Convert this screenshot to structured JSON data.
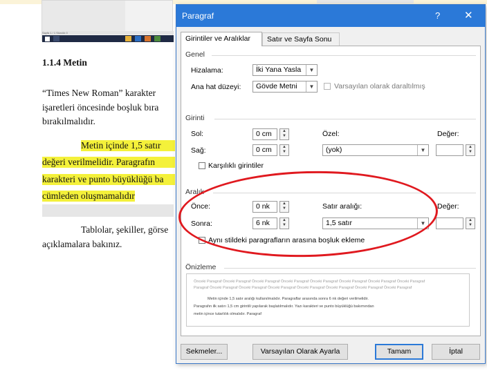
{
  "document": {
    "status_bar": "Sayfa 1 / 1   Sözcük 0",
    "heading": "1.1.4 Metin",
    "paragraph1": [
      "“Times New Roman” karakter",
      "işaretleri öncesinde boşluk bıra",
      "bırakılmalıdır."
    ],
    "highlighted": [
      "Metin içinde 1,5 satır",
      "değeri verilmelidir. Paragrafın",
      "karakteri ve punto büyüklüğü ba",
      "cümleden oluşmamalıdır"
    ],
    "paragraph2": [
      "Tablolar, şekiller, görse",
      "açıklamalara bakınız."
    ],
    "highlight_color": "#f4f13a"
  },
  "dialog": {
    "title": "Paragraf",
    "help": "?",
    "close": "✕",
    "accent_color": "#2b79d8",
    "tabs": [
      "Girintiler ve Aralıklar",
      "Satır ve Sayfa Sonu"
    ],
    "genel": {
      "section": "Genel",
      "alignment_label": "Hizalama:",
      "alignment_value": "İki Yana Yasla",
      "outline_label": "Ana hat düzeyi:",
      "outline_value": "Gövde Metni",
      "collapsed_label": "Varsayılan olarak daraltılmış"
    },
    "girinti": {
      "section": "Girinti",
      "left_label": "Sol:",
      "left_value": "0 cm",
      "right_label": "Sağ:",
      "right_value": "0 cm",
      "special_label": "Özel:",
      "special_value": "(yok)",
      "value_label": "Değer:",
      "mirror_label": "Karşılıklı girintiler"
    },
    "aralik": {
      "section": "Aralık",
      "before_label": "Önce:",
      "before_value": "0 nk",
      "after_label": "Sonra:",
      "after_value": "6 nk",
      "line_label": "Satır aralığı:",
      "line_value": "1,5 satır",
      "value_label": "Değer:",
      "no_space_label": "Aynı stildeki paragrafların arasına boşluk ekleme"
    },
    "preview": {
      "section": "Önizleme",
      "lines_before": [
        "Önceki Paragraf Önceki Paragraf Önceki Paragraf Önceki Paragraf Önceki Paragraf Önceki Paragraf Önceki Paragraf Önceki Paragraf",
        "Paragraf Önceki Paragraf Önceki Paragraf Önceki Paragraf Önceki Paragraf Önceki Paragraf Önceki Paragraf Önceki Paragraf"
      ],
      "lines_main": [
        "Metin içinde 1,5 satır aralığı kullanılmalıdır. Paragraflar arasında sonra 6 nk değeri verilmelidir.",
        "Paragrafın ilk satırı 1,5 cm girintili yapılarak başlatılmalıdır. Yazı karakteri ve punto büyüklüğü bakımından",
        "metin içince tutarlılık olmalıdır. Paragraf"
      ]
    },
    "buttons": {
      "tabs_btn": "Sekmeler...",
      "default_btn": "Varsayılan Olarak Ayarla",
      "ok_btn": "Tamam",
      "cancel_btn": "İptal"
    },
    "annotation_color": "#e0191f"
  }
}
